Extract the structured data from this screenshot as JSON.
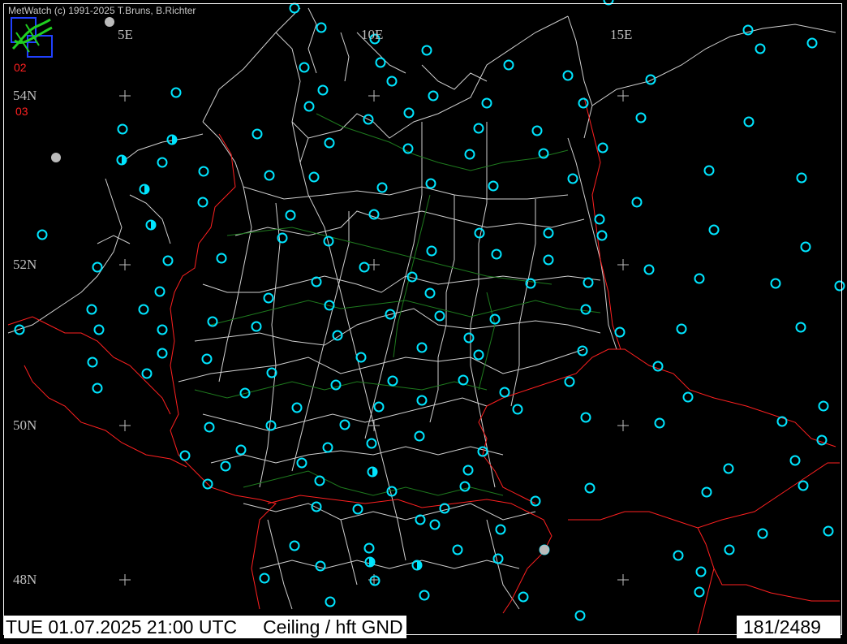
{
  "app": {
    "credit": "MetWatch  (c) 1991-2025 T.Bruns, B.Richter"
  },
  "map": {
    "lon_labels": [
      "5E",
      "10E",
      "15E"
    ],
    "lat_labels": [
      "54N",
      "52N",
      "50N",
      "48N"
    ],
    "run_labels": [
      "02",
      "03"
    ],
    "colors": {
      "background": "#000000",
      "station": "#00e5ff",
      "other_station": "#bbbbbb",
      "border": "#ff2020",
      "admin_line": "#d0d0d0",
      "river": "#1e7a1e"
    },
    "station_symbol": "clear-sky-circle-icon"
  },
  "status": {
    "datetime": "TUE 01.07.2025 21:00 UTC",
    "parameter": "Ceiling / hft GND",
    "count": "181/2489"
  }
}
